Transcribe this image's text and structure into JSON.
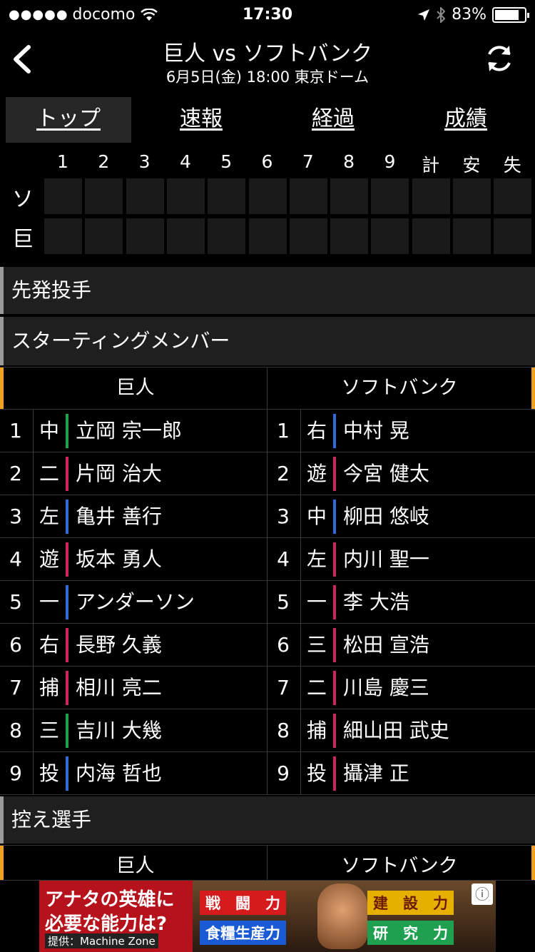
{
  "status": {
    "carrier": "docomo",
    "time": "17:30",
    "battery": "83%",
    "battery_level": 0.83,
    "signal_dots": "●●●●●"
  },
  "nav": {
    "title": "巨人 vs ソフトバンク",
    "subtitle": "6月5日(金) 18:00 東京ドーム"
  },
  "tabs": [
    "トップ",
    "速報",
    "経過",
    "成績"
  ],
  "scoreboard": {
    "headers": [
      "1",
      "2",
      "3",
      "4",
      "5",
      "6",
      "7",
      "8",
      "9",
      "計",
      "安",
      "失"
    ],
    "teams": [
      "ソ",
      "巨"
    ]
  },
  "sections": {
    "starting_pitchers": "先発投手",
    "starting_members": "スターティングメンバー",
    "bench": "控え選手"
  },
  "columns": {
    "home": "巨人",
    "away": "ソフトバンク"
  },
  "lineup": {
    "home": [
      {
        "order": "1",
        "pos": "中",
        "name": "立岡 宗一郎",
        "color": "#1fa34a"
      },
      {
        "order": "2",
        "pos": "二",
        "name": "片岡 治大",
        "color": "#d0245e"
      },
      {
        "order": "3",
        "pos": "左",
        "name": "亀井 善行",
        "color": "#2e6bd6"
      },
      {
        "order": "4",
        "pos": "遊",
        "name": "坂本 勇人",
        "color": "#d0245e"
      },
      {
        "order": "5",
        "pos": "一",
        "name": "アンダーソン",
        "color": "#2e6bd6"
      },
      {
        "order": "6",
        "pos": "右",
        "name": "長野 久義",
        "color": "#d0245e"
      },
      {
        "order": "7",
        "pos": "捕",
        "name": "相川 亮二",
        "color": "#d0245e"
      },
      {
        "order": "8",
        "pos": "三",
        "name": "吉川 大幾",
        "color": "#1fa34a"
      },
      {
        "order": "9",
        "pos": "投",
        "name": "内海 哲也",
        "color": "#2e6bd6"
      }
    ],
    "away": [
      {
        "order": "1",
        "pos": "右",
        "name": "中村 晃",
        "color": "#2e6bd6"
      },
      {
        "order": "2",
        "pos": "遊",
        "name": "今宮 健太",
        "color": "#d0245e"
      },
      {
        "order": "3",
        "pos": "中",
        "name": "柳田 悠岐",
        "color": "#2e6bd6"
      },
      {
        "order": "4",
        "pos": "左",
        "name": "内川 聖一",
        "color": "#d0245e"
      },
      {
        "order": "5",
        "pos": "一",
        "name": "李 大浩",
        "color": "#d0245e"
      },
      {
        "order": "6",
        "pos": "三",
        "name": "松田 宣浩",
        "color": "#d0245e"
      },
      {
        "order": "7",
        "pos": "二",
        "name": "川島 慶三",
        "color": "#d0245e"
      },
      {
        "order": "8",
        "pos": "捕",
        "name": "細山田 武史",
        "color": "#d0245e"
      },
      {
        "order": "9",
        "pos": "投",
        "name": "攝津 正",
        "color": "#d0245e"
      }
    ]
  },
  "ad": {
    "line1": "アナタの英雄に",
    "line2": "必要な能力は?",
    "source": "提供：Machine Zone",
    "labels": [
      "戦　闘　力",
      "食糧生産力",
      "建　設　力",
      "研　究　力"
    ]
  }
}
